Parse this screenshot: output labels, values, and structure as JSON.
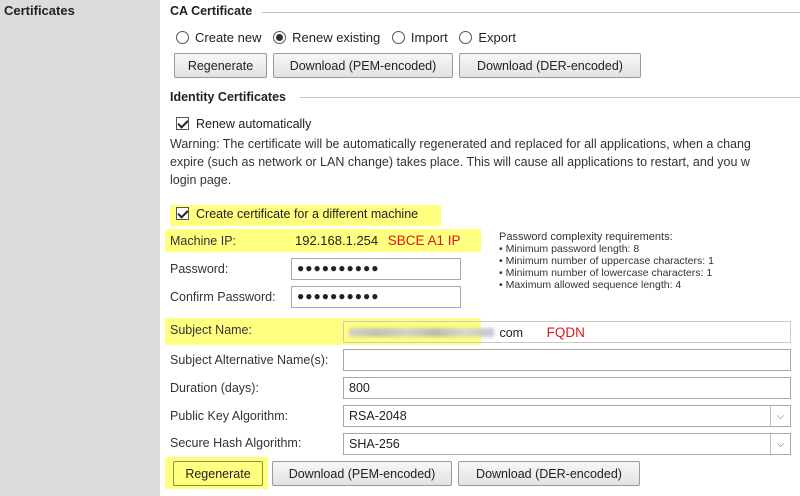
{
  "sidebar": {
    "section_title": "Certificates"
  },
  "ca": {
    "heading": "CA Certificate",
    "options": [
      {
        "label": "Create new",
        "selected": false
      },
      {
        "label": "Renew existing",
        "selected": true
      },
      {
        "label": "Import",
        "selected": false
      },
      {
        "label": "Export",
        "selected": false
      }
    ],
    "buttons": [
      "Regenerate",
      "Download (PEM-encoded)",
      "Download (DER-encoded)"
    ]
  },
  "identity": {
    "heading": "Identity Certificates",
    "renew_auto_label": "Renew automatically",
    "renew_auto_checked": true,
    "warning_lines": [
      "Warning: The certificate will be automatically regenerated and replaced for all applications, when a chang",
      "expire (such as network or LAN change) takes place. This will cause all applications to restart, and you w",
      "login page."
    ],
    "diff_machine_label": "Create certificate for a different machine",
    "diff_machine_checked": true,
    "machine_ip_label": "Machine IP:",
    "machine_ip_value": "192.168.1.254",
    "machine_ip_annotation": "SBCE A1 IP",
    "password_label": "Password:",
    "password_value": "●●●●●●●●●●",
    "confirm_label": "Confirm Password:",
    "confirm_value": "●●●●●●●●●●",
    "requirements": {
      "title": "Password complexity requirements:",
      "items": [
        "• Minimum password length: 8",
        "• Minimum number of uppercase characters: 1",
        "• Minimum number of lowercase characters: 1",
        "• Maximum allowed sequence length: 4"
      ]
    },
    "subject_name_label": "Subject Name:",
    "subject_name_suffix": "com",
    "subject_name_annotation": "FQDN",
    "san_label": "Subject Alternative Name(s):",
    "san_value": "",
    "duration_label": "Duration (days):",
    "duration_value": "800",
    "pka_label": "Public Key Algorithm:",
    "pka_value": "RSA-2048",
    "hash_label": "Secure Hash Algorithm:",
    "hash_value": "SHA-256",
    "buttons": [
      "Regenerate",
      "Download (PEM-encoded)",
      "Download (DER-encoded)"
    ]
  },
  "colors": {
    "highlight": "#ffff80",
    "annotation": "#e2141a",
    "sidebar": "#dcdcdc"
  }
}
